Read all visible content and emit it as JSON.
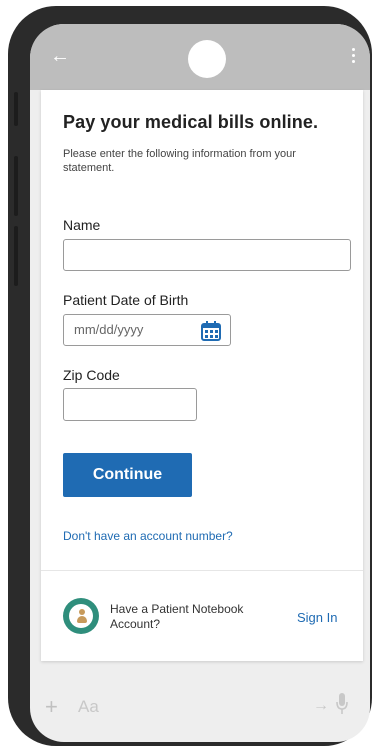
{
  "form": {
    "title": "Pay your medical bills online.",
    "subtitle": "Please enter the following information from your statement.",
    "name_label": "Name",
    "name_value": "",
    "dob_label": "Patient Date of Birth",
    "dob_placeholder": "mm/dd/yyyy",
    "zip_label": "Zip Code",
    "zip_value": "",
    "continue_label": "Continue",
    "no_account_link": "Don't have an account number?"
  },
  "account_prompt": {
    "text": "Have a Patient Notebook Account?",
    "sign_in_label": "Sign In"
  },
  "composer": {
    "add_icon": "+",
    "text_placeholder": "Aa",
    "send_icon": "→",
    "mic_icon": "microphone-icon"
  },
  "colors": {
    "accent": "#1f6bb3",
    "brand_icon": "#2f8e7c"
  }
}
